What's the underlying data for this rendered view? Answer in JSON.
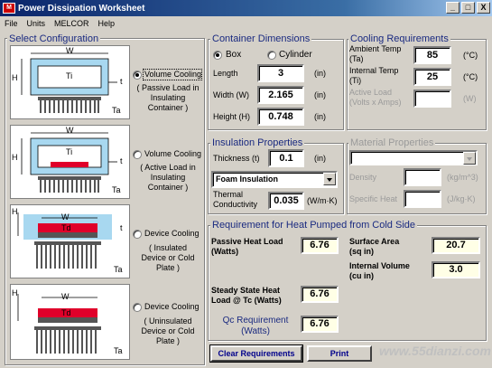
{
  "window": {
    "title": "Power Dissipation Worksheet",
    "app_icon_text": "M",
    "buttons": {
      "minimize": "_",
      "maximize": "□",
      "close": "X"
    }
  },
  "menu": [
    "File",
    "Units",
    "MELCOR",
    "Help"
  ],
  "select_configuration": {
    "title": "Select Configuration",
    "options": [
      {
        "label": "Volume Cooling",
        "sub": "( Passive Load in Insulating Container )",
        "selected": true
      },
      {
        "label": "Volume Cooling",
        "sub": "( Active Load in Insulating Container )",
        "selected": false
      },
      {
        "label": "Device Cooling",
        "sub": "( Insulated Device or Cold Plate )",
        "selected": false
      },
      {
        "label": "Device Cooling",
        "sub": "( Uninsulated Device or Cold Plate )",
        "selected": false
      }
    ],
    "diagram_labels": {
      "w": "W",
      "h": "H",
      "ti": "Ti",
      "t": "t",
      "ta": "Ta",
      "td": "Td"
    }
  },
  "container_dimensions": {
    "title": "Container Dimensions",
    "shape_box": "Box",
    "shape_cylinder": "Cylinder",
    "selected_shape": "box",
    "length_label": "Length",
    "length_value": "3",
    "width_label": "Width (W)",
    "width_value": "2.165",
    "height_label": "Height (H)",
    "height_value": "0.748",
    "unit": "(in)"
  },
  "cooling_requirements": {
    "title": "Cooling Requirements",
    "ambient_label_1": "Ambient Temp",
    "ambient_label_2": "(Ta)",
    "ambient_value": "85",
    "internal_label_1": "Internal Temp",
    "internal_label_2": "(Ti)",
    "internal_value": "25",
    "active_label_1": "Active Load",
    "active_label_2": "(Volts x Amps)",
    "active_value": "",
    "unit_temp": "(°C)",
    "unit_power": "(W)"
  },
  "insulation_properties": {
    "title": "Insulation Properties",
    "thickness_label": "Thickness (t)",
    "thickness_value": "0.1",
    "thickness_unit": "(in)",
    "material": "Foam Insulation",
    "thermal_label_1": "Thermal",
    "thermal_label_2": "Conductivity",
    "thermal_value": "0.035",
    "thermal_unit": "(W/m·K)"
  },
  "material_properties": {
    "title": "Material Properties",
    "density_label": "Density",
    "density_unit": "(kg/m^3)",
    "specific_heat_label": "Specific Heat",
    "specific_heat_unit": "(J/kg·K)"
  },
  "heat_requirement": {
    "title": "Requirement for Heat Pumped from Cold Side",
    "passive_label_1": "Passive Heat Load",
    "passive_label_2": "(Watts)",
    "passive_value": "6.76",
    "surface_label_1": "Surface Area",
    "surface_label_2": "(sq in)",
    "surface_value": "20.7",
    "volume_label_1": "Internal Volume",
    "volume_label_2": "(cu in)",
    "volume_value": "3.0",
    "steady_label_1": "Steady State Heat",
    "steady_label_2": "Load @ Tc (Watts)",
    "steady_value": "6.76",
    "qc_label_1": "Qc Requirement",
    "qc_label_2": "(Watts)",
    "qc_value": "6.76"
  },
  "buttons": {
    "clear": "Clear Requirements",
    "print": "Print"
  },
  "watermark": "www.55dianzi.com",
  "colors": {
    "title_bar": "#0a246a",
    "group_title": "#1a2a80",
    "heater_red": "#e0002a",
    "insulation_blue": "#a8d8f0",
    "button_text": "#00008b"
  }
}
